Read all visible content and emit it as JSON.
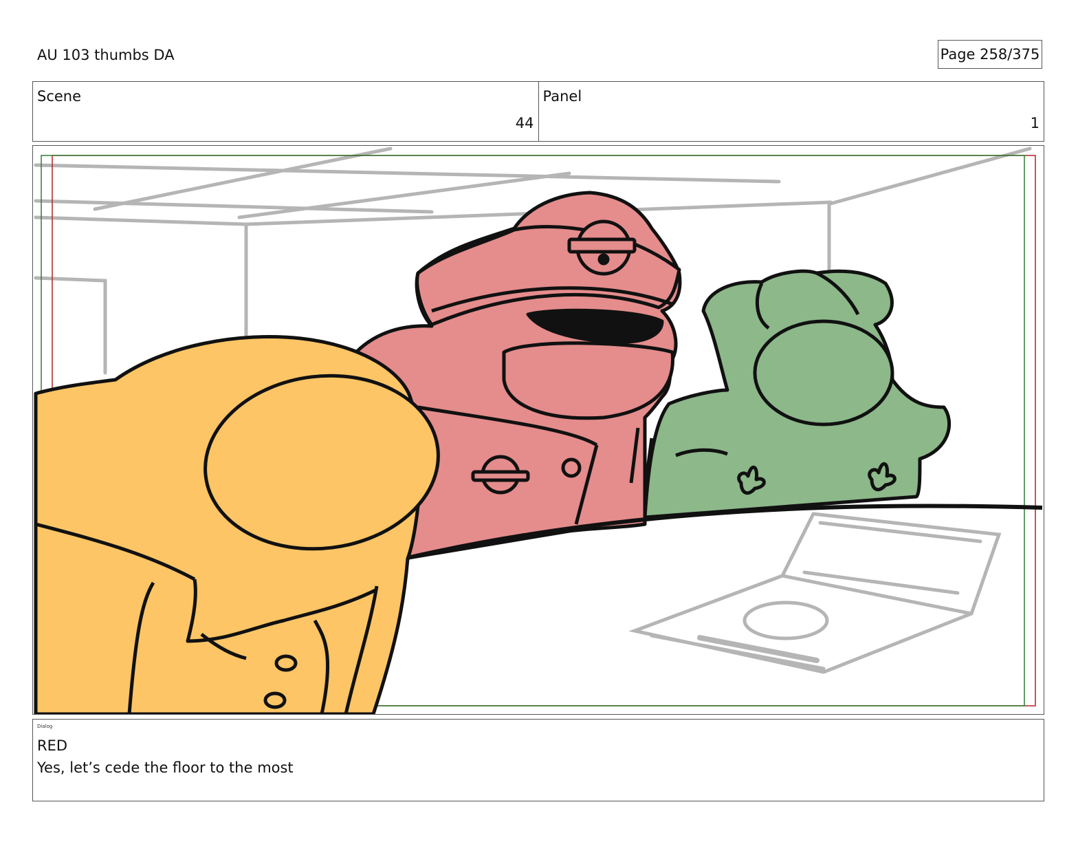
{
  "header": {
    "doc_title": "AU 103 thumbs DA",
    "page_label": "Page 258/375"
  },
  "meta": {
    "scene_label": "Scene",
    "scene_value": "44",
    "panel_label": "Panel",
    "panel_value": "1"
  },
  "panel": {
    "colors": {
      "yellow_character": "#FDC565",
      "red_character": "#E58C8C",
      "green_character": "#8DB88A",
      "sketch_lines": "#B5B5B5",
      "safe_frame_red": "#B22222",
      "safe_frame_green": "#2E7D32"
    }
  },
  "dialog": {
    "label": "Dialog",
    "speaker": "RED",
    "line": "Yes, let’s cede the floor to the most"
  }
}
